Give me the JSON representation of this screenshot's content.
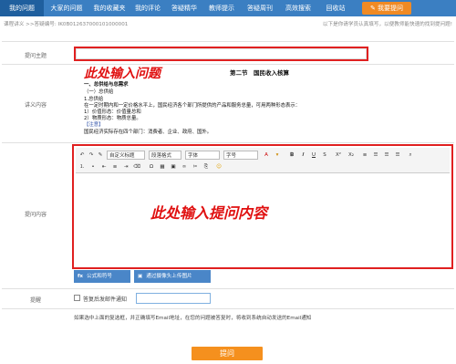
{
  "nav": {
    "items": [
      "我的问题",
      "大家的问题",
      "我的收藏夹",
      "我的评论",
      "答疑精华",
      "教师提示",
      "答疑周刊",
      "高效搜索",
      "回收站"
    ],
    "active_index": 0,
    "ask_button": "我要提问"
  },
  "breadcrumb": "课程讲义 >>答疑编号: IK0B012637000101000001",
  "hint": "以下是你请学员认真填写，以便教师能快速的找到提问题!",
  "form": {
    "subject_label": "提问主题",
    "subject_annotation": "此处输入问题",
    "lecture_label": "讲义内容",
    "content_label": "提问内容",
    "content_annotation": "此处输入提问内容",
    "remind_label": "提醒",
    "notify_checkbox_label": "答复后发邮件通知",
    "formula_button": "公式和符号",
    "upload_button": "通过摄像头上传图片",
    "footnote": "如果选中上面的复选框，并正确填写Email地址，在您的问题被答复时，将收到系统自动发送的Email通知",
    "submit_button": "提问"
  },
  "lecture": {
    "section_title": "第二节　国民收入核算",
    "lines": [
      "一、总供给与总需求",
      "（一）总供给",
      "1.总供给",
      "在一定时期内和一定价格水平上，国民经济各个部门所提供的产品和服务总量，可用两种形态表示：",
      "1）价值形态：价值量总和",
      "2）物质形态：物质总量。",
      "【注意】",
      "国民经济实际存在四个部门：消费者、企业、政府、国外。"
    ]
  },
  "toolbar": {
    "style_select": "自定义标题",
    "paragraph_select": "段落格式",
    "font_select": "字体",
    "size_select": "字号",
    "buttons_row1": [
      "↶",
      "↷",
      "✎",
      "𝐁",
      "𝐈",
      "U",
      "X²",
      "X₂",
      "≡"
    ],
    "buttons_row2": [
      "⇤",
      "≡",
      "⇥",
      "Ω",
      "▦",
      "☺"
    ]
  }
}
